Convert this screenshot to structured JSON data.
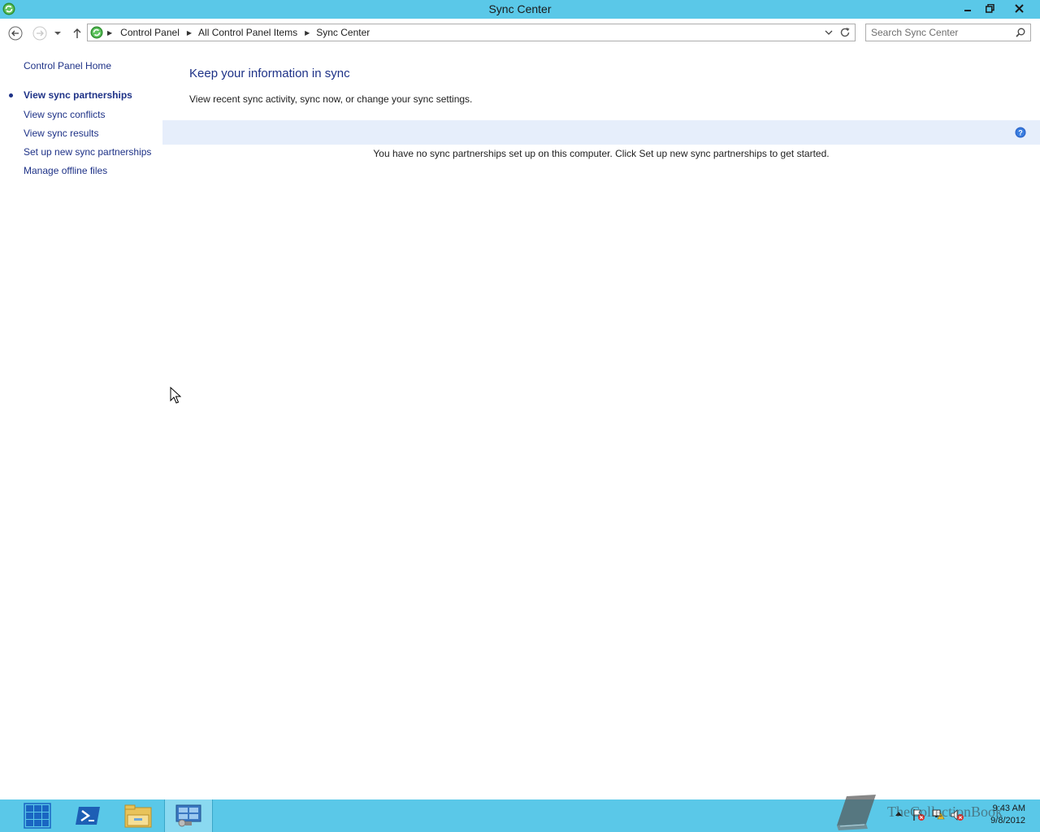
{
  "window": {
    "title": "Sync Center"
  },
  "address": {
    "crumbs": [
      "Control Panel",
      "All Control Panel Items",
      "Sync Center"
    ],
    "search_placeholder": "Search Sync Center"
  },
  "sidebar": {
    "home_label": "Control Panel Home",
    "items": [
      {
        "label": "View sync partnerships",
        "selected": true
      },
      {
        "label": "View sync conflicts"
      },
      {
        "label": "View sync results"
      },
      {
        "label": "Set up new sync partnerships"
      },
      {
        "label": "Manage offline files"
      }
    ]
  },
  "main": {
    "title": "Keep your information in sync",
    "description": "View recent sync activity, sync now, or change your sync settings.",
    "empty_message": "You have no sync partnerships set up on this computer. Click Set up new sync partnerships to get started."
  },
  "taskbar": {
    "apps": [
      "start-icon",
      "powershell-icon",
      "file-explorer-icon",
      "control-panel-icon"
    ],
    "watermark": "TheCollectionBook",
    "clock_time": "9:43 AM",
    "clock_date": "9/8/2012"
  },
  "colors": {
    "titlebar": "#5ac8e8",
    "link": "#1e3287",
    "infobar": "#e6eefb"
  }
}
